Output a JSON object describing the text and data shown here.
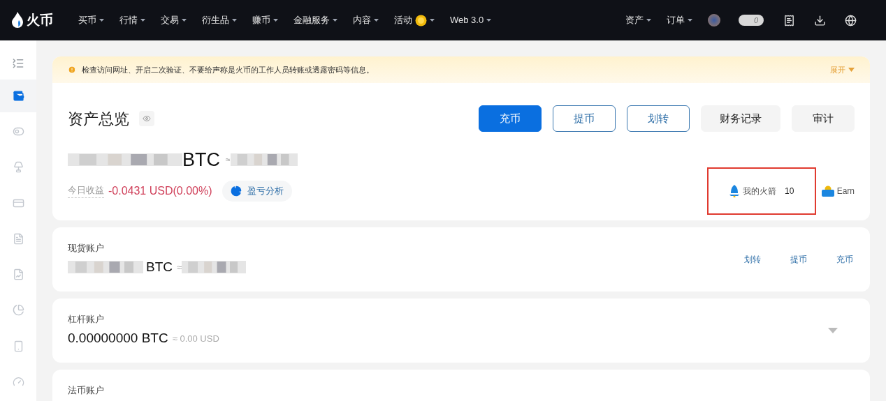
{
  "header": {
    "logo": "火币",
    "nav": [
      {
        "label": "买币",
        "coin": false
      },
      {
        "label": "行情",
        "coin": false
      },
      {
        "label": "交易",
        "coin": false
      },
      {
        "label": "衍生品",
        "coin": false
      },
      {
        "label": "赚币",
        "coin": false
      },
      {
        "label": "金融服务",
        "coin": false
      },
      {
        "label": "内容",
        "coin": false
      },
      {
        "label": "活动",
        "coin": true
      },
      {
        "label": "Web 3.0",
        "coin": false
      }
    ],
    "right_menus": [
      {
        "label": "资产"
      },
      {
        "label": "订单"
      }
    ],
    "message_count": "0"
  },
  "sidebar": {
    "items": [
      {
        "kind": "wallet",
        "selected": true
      },
      {
        "kind": "toggle",
        "selected": false
      },
      {
        "kind": "lamp",
        "selected": false
      },
      {
        "kind": "card",
        "selected": false
      },
      {
        "kind": "doc",
        "selected": false
      },
      {
        "kind": "chart",
        "selected": false
      },
      {
        "kind": "pie",
        "selected": false
      },
      {
        "kind": "device",
        "selected": false
      },
      {
        "kind": "gauge",
        "selected": false
      }
    ]
  },
  "notice": {
    "text": "检查访问网址、开启二次验证、不要给声称是火币的工作人员转账或透露密码等信息。",
    "expand": "展开"
  },
  "overview": {
    "title": "资产总览",
    "actions": [
      {
        "label": "充币",
        "kind": "primary"
      },
      {
        "label": "提币",
        "kind": "outline"
      },
      {
        "label": "划转",
        "kind": "outline"
      },
      {
        "label": "财务记录",
        "kind": "gray"
      },
      {
        "label": "审计",
        "kind": "gray"
      }
    ],
    "balance_unit": "BTC",
    "approx": "≈",
    "today_label": "今日收益",
    "today_value": "-0.0431 USD(0.00%)",
    "pnl_button": "盈亏分析",
    "rocket_label": "我的火箭",
    "rocket_count": "10",
    "highlighted": true,
    "earn": "Earn"
  },
  "accounts": [
    {
      "title": "现货账户",
      "value": "BTC",
      "approx": "≈",
      "hidden": true,
      "links": [
        "划转",
        "提币",
        "充币"
      ],
      "collapsible": false
    },
    {
      "title": "杠杆账户",
      "value": "0.00000000 BTC",
      "approx": "≈ 0.00 USD",
      "hidden": false,
      "collapsible": true
    },
    {
      "title": "法币账户"
    }
  ]
}
